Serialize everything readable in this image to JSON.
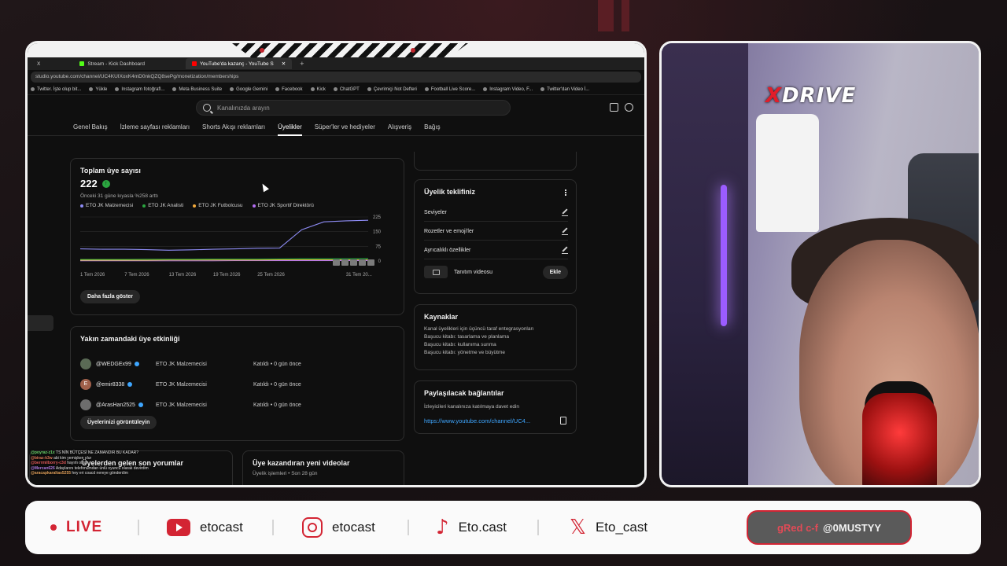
{
  "browser": {
    "tabs": [
      {
        "label": "X",
        "active": false
      },
      {
        "label": "Stream - Kick Dashboard",
        "active": false
      },
      {
        "label": "YouTube'da kazanç - YouTube S",
        "active": true
      }
    ],
    "new_tab": "+",
    "url": "studio.youtube.com/channel/UC4KUIXoxK4mD0nkQZQ8sePg/monetization/memberships",
    "bookmarks": [
      "Twitter. İşte olup bit...",
      "Yükle",
      "Instagram fotoğrafl...",
      "Meta Business Suite",
      "Google Gemini",
      "Facebook",
      "Kick",
      "ChatGPT",
      "Çevrimiçi Not Defteri",
      "Football Live Score...",
      "Instagram Video, F...",
      "Twitter'dan Video İ..."
    ]
  },
  "studio": {
    "search_placeholder": "Kanalınızda arayın",
    "tabs": [
      {
        "label": "Genel Bakış",
        "active": false
      },
      {
        "label": "İzleme sayfası reklamları",
        "active": false
      },
      {
        "label": "Shorts Akışı reklamları",
        "active": false
      },
      {
        "label": "Üyelikler",
        "active": true
      },
      {
        "label": "Süper'ler ve hediyeler",
        "active": false
      },
      {
        "label": "Alışveriş",
        "active": false
      },
      {
        "label": "Bağış",
        "active": false
      }
    ],
    "total_members": {
      "title": "Toplam üye sayısı",
      "value": "222",
      "comparison": "Önceki 31 güne kıyasla %258 arttı",
      "legend": [
        {
          "label": "ETO JK Malzemecisi",
          "color": "#8e8cf5"
        },
        {
          "label": "ETO JK Analisti",
          "color": "#2ba640"
        },
        {
          "label": "ETO JK Futbolcusu",
          "color": "#f2a93b"
        },
        {
          "label": "ETO JK Sportif Direktörü",
          "color": "#b36df2"
        }
      ],
      "show_more": "Daha fazla göster"
    },
    "chart_data": {
      "type": "line",
      "x": [
        "1 Tem 2026",
        "4 Tem 2026",
        "7 Tem 2026",
        "10 Tem 2026",
        "13 Tem 2026",
        "16 Tem 2026",
        "19 Tem 2026",
        "22 Tem 2026",
        "25 Tem 2026",
        "28 Tem 2026",
        "29 Tem 2026",
        "30 Tem 2026",
        "31 Tem 2026",
        "1 Ağu 2026"
      ],
      "xticks": [
        "1 Tem 2026",
        "7 Tem 2026",
        "13 Tem 2026",
        "19 Tem 2026",
        "25 Tem 2026",
        "31 Tem 20..."
      ],
      "yticks": [
        "225",
        "150",
        "75",
        "0"
      ],
      "ylim": [
        0,
        225
      ],
      "series": [
        {
          "name": "ETO JK Malzemecisi",
          "values": [
            62,
            60,
            60,
            58,
            55,
            57,
            60,
            62,
            65,
            66,
            160,
            200,
            205,
            208
          ]
        },
        {
          "name": "ETO JK Analisti",
          "values": [
            8,
            8,
            8,
            9,
            9,
            9,
            10,
            10,
            10,
            11,
            12,
            12,
            12,
            13
          ]
        },
        {
          "name": "ETO JK Futbolcusu",
          "values": [
            4,
            4,
            4,
            4,
            5,
            5,
            5,
            5,
            5,
            6,
            6,
            6,
            6,
            6
          ]
        },
        {
          "name": "ETO JK Sportif Direktörü",
          "values": [
            1,
            1,
            1,
            1,
            1,
            1,
            1,
            2,
            2,
            2,
            2,
            2,
            2,
            2
          ]
        }
      ]
    },
    "recent_activity": {
      "title": "Yakın zamandaki üye etkinliği",
      "rows": [
        {
          "avatar_letter": "",
          "name": "@WEDGEx99",
          "level": "ETO JK Malzemecisi",
          "time": "Katıldı • 0 gün önce",
          "avatar_color": "#5a6a55"
        },
        {
          "avatar_letter": "E",
          "name": "@emir8338",
          "level": "ETO JK Malzemecisi",
          "time": "Katıldı • 0 gün önce",
          "avatar_color": "#a0604a"
        },
        {
          "avatar_letter": "",
          "name": "@ArasHan2525",
          "level": "ETO JK Malzemecisi",
          "time": "Katıldı • 0 gün önce",
          "avatar_color": "#6d6d6d"
        }
      ],
      "view_members": "Üyelerinizi görüntüleyin"
    },
    "member_comments": {
      "title": "Üyelerden gelen son yorumlar"
    },
    "earning_videos": {
      "title": "Üye kazandıran yeni videolar",
      "subtitle": "Üyelik işlemleri • Son 28 gün"
    },
    "offer": {
      "title": "Üyelik teklifiniz",
      "rows": [
        "Seviyeler",
        "Rozetler ve emoji'ler",
        "Ayrıcalıklı özellikler"
      ],
      "promo_video": "Tanıtım videosu",
      "add_button": "Ekle"
    },
    "sources": {
      "title": "Kaynaklar",
      "lines": [
        "Kanal üyelikleri için üçüncü taraf entegrasyonları",
        "Başucu kitabı: tasarlama ve planlama",
        "Başucu kitabı: kullanıma sunma",
        "Başucu kitabı: yönetme ve büyütme"
      ]
    },
    "share": {
      "title": "Paylaşılacak bağlantılar",
      "description": "İzleyicileri kanalınıza katılmaya davet edin",
      "link": "https://www.youtube.com/channel/UC4..."
    },
    "chat": [
      {
        "user": "@poyraz-z1x",
        "text": "TS NİN BÜTÇESİ NE ZAMANDIR BU KADAR?",
        "color": "#6bd36b"
      },
      {
        "user": "@biraz-k3w",
        "text": "abi kim yemişken olur",
        "color": "#e07b5a"
      },
      {
        "user": "@berrmilborry-c3d",
        "text": "hayırlı olsun",
        "color": "#e05a5a"
      },
      {
        "user": "@Mercan626",
        "text": "Adaylarını telefonumdan ünlü oyuncu olarak devirdim",
        "color": "#b07be0"
      },
      {
        "user": "@aracapkaraltas5255",
        "text": "hey eri coacd nereye gönderdim",
        "color": "#e0a05a"
      }
    ]
  },
  "webcam": {
    "logo_prefix": "X",
    "logo_rest": "DRIVE"
  },
  "social_bar": {
    "live_label": "LIVE",
    "youtube": "etocast",
    "instagram": "etocast",
    "tiktok": "Eto.cast",
    "x": "Eto_cast",
    "follow_prefix": "gRed c-f",
    "follow_handle": "@0MUSTYY"
  },
  "colors": {
    "accent": "#d32433",
    "link": "#3ea6ff",
    "verified": "#3ea6ff"
  }
}
